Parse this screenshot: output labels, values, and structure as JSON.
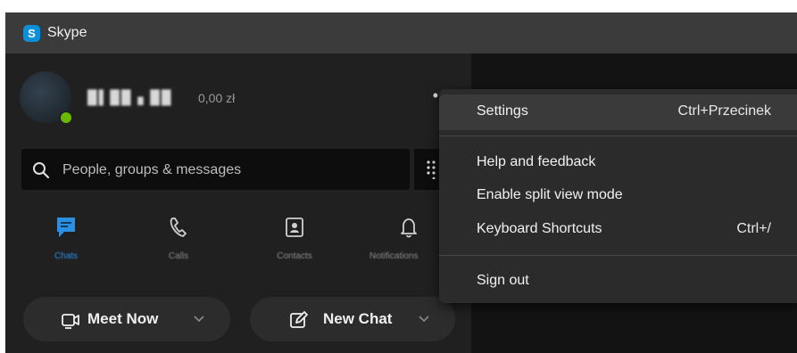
{
  "app": {
    "title": "Skype",
    "logo_letter": "S"
  },
  "profile": {
    "name": "█▌██ ▖██",
    "credit": "0,00 zł",
    "more_label": "••"
  },
  "search": {
    "placeholder": "People, groups & messages"
  },
  "nav": {
    "items": [
      {
        "label": "Chats",
        "icon": "chat-icon",
        "active": true
      },
      {
        "label": "Calls",
        "icon": "phone-icon",
        "active": false
      },
      {
        "label": "Contacts",
        "icon": "contact-card-icon",
        "active": false
      },
      {
        "label": "Notifications",
        "icon": "bell-icon",
        "active": false
      }
    ]
  },
  "actions": {
    "meet_now": "Meet Now",
    "new_chat": "New Chat"
  },
  "menu": {
    "items": [
      {
        "label": "Settings",
        "shortcut": "Ctrl+Przecinek"
      },
      {
        "label": "Help and feedback",
        "shortcut": ""
      },
      {
        "label": "Enable split view mode",
        "shortcut": ""
      },
      {
        "label": "Keyboard Shortcuts",
        "shortcut": "Ctrl+/"
      },
      {
        "label": "Sign out",
        "shortcut": ""
      }
    ]
  },
  "colors": {
    "accent": "#2d8fe0",
    "presence": "#6bb700",
    "brand": "#0a8fd8"
  }
}
